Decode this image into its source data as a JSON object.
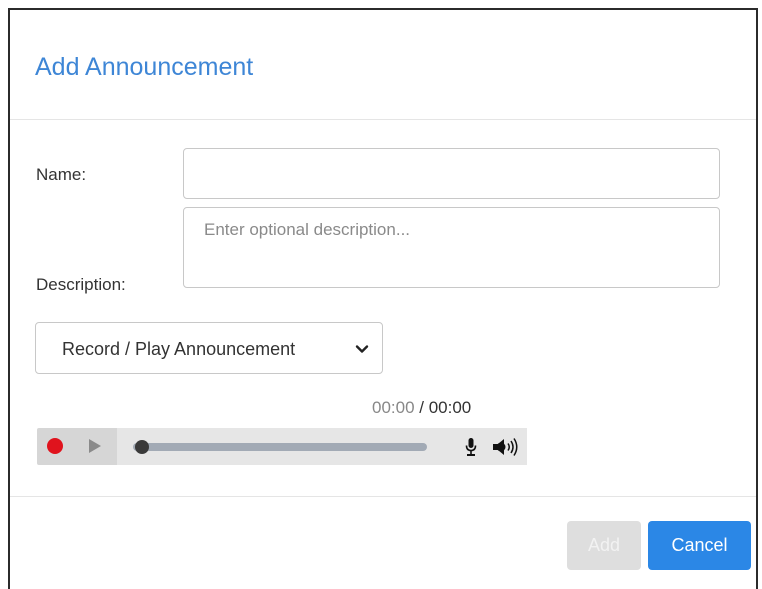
{
  "dialog": {
    "title": "Add Announcement"
  },
  "form": {
    "name_label": "Name:",
    "name_value": "",
    "description_label": "Description:",
    "description_value": "",
    "description_placeholder": "Enter optional description...",
    "mode_select": {
      "selected": "Record / Play Announcement"
    }
  },
  "player": {
    "current_time": "00:00",
    "separator": " / ",
    "total_time": "00:00",
    "progress": 0,
    "icons": {
      "record": "record-icon",
      "play": "play-icon",
      "mic": "microphone-icon",
      "volume": "speaker-icon"
    },
    "colors": {
      "record": "#e0131d"
    }
  },
  "footer": {
    "add_label": "Add",
    "cancel_label": "Cancel"
  },
  "colors": {
    "accent": "#2b87e6",
    "title": "#3e86d6"
  }
}
